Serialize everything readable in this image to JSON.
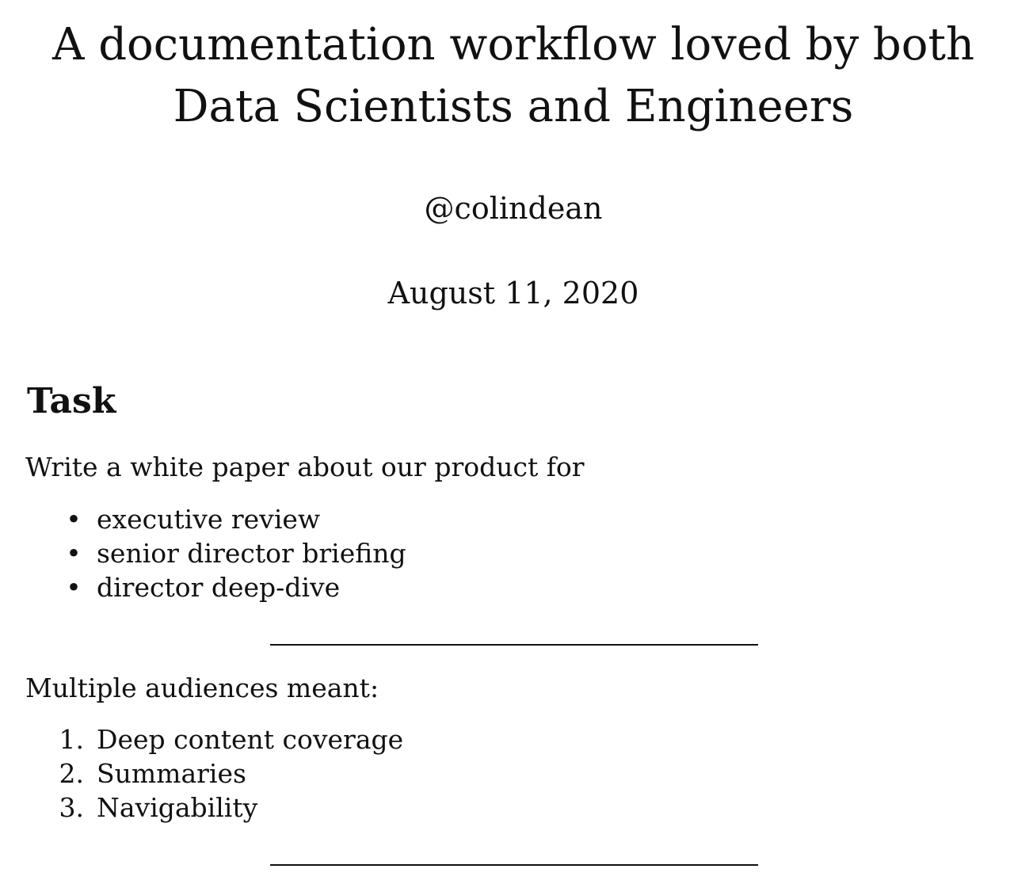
{
  "title": "A documentation workflow loved by both Data Scientists and Engineers",
  "author": "@colindean",
  "date": "August 11, 2020",
  "section": {
    "heading": "Task",
    "intro": "Write a white paper about our product for",
    "bullets": [
      "executive review",
      "senior director briefing",
      "director deep-dive"
    ],
    "followup": "Multiple audiences meant:",
    "numbered": [
      {
        "marker": "1.",
        "text": "Deep content coverage"
      },
      {
        "marker": "2.",
        "text": "Summaries"
      },
      {
        "marker": "3.",
        "text": "Navigability"
      }
    ]
  }
}
